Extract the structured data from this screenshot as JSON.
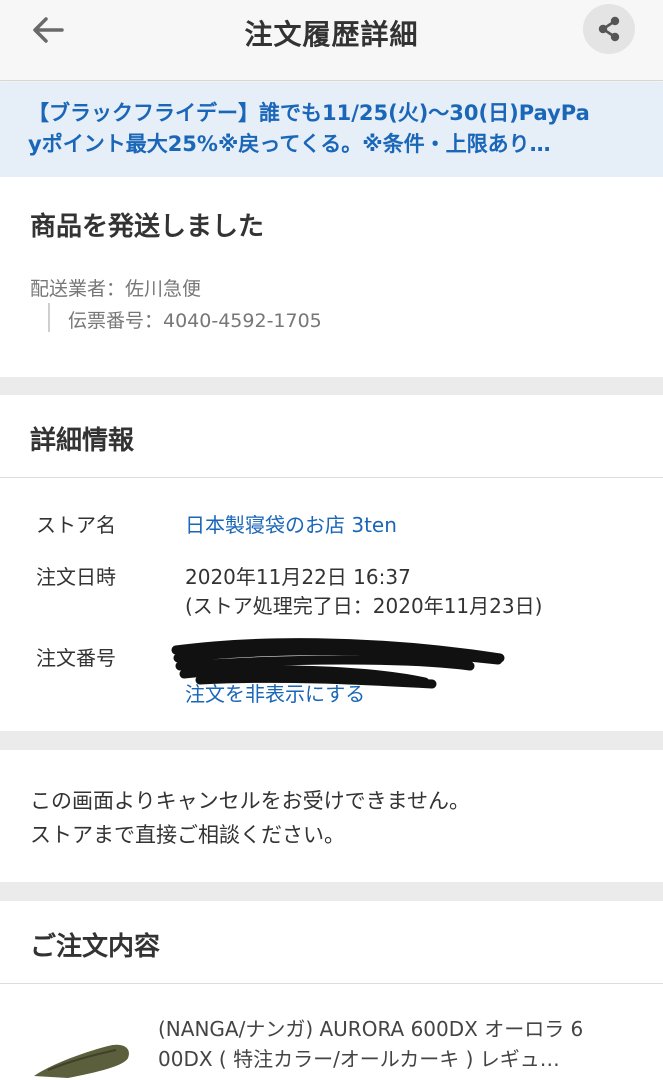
{
  "header": {
    "title": "注文履歴詳細",
    "back_icon": "arrow-left-icon",
    "share_icon": "share-icon"
  },
  "promo": {
    "line1": "【ブラックフライデー】誰でも11/25(火)～30(日)PayPa",
    "line2": "yポイント最大25%※戻ってくる。※条件・上限あり…"
  },
  "shipping": {
    "status": "商品を発送しました",
    "carrier": "配送業者：佐川急便",
    "tracking": "伝票番号：4040-4592-1705"
  },
  "details": {
    "heading": "詳細情報",
    "store_label": "ストア名",
    "store_value": "日本製寝袋のお店 3ten",
    "date_label": "注文日時",
    "date_value": "2020年11月22日 16:37",
    "date_sub": "(ストア処理完了日：2020年11月23日)",
    "order_label": "注文番号",
    "hide_link": "注文を非表示にする"
  },
  "notice": {
    "line1": "この画面よりキャンセルをお受けできません。",
    "line2": "ストアまで直接ご相談ください。"
  },
  "order": {
    "heading": "ご注文内容",
    "product_line1": "(NANGA/ナンガ) AURORA 600DX オーロラ 6",
    "product_line2": "00DX ( 特注カラー/オールカーキ ) レギュ…"
  },
  "colors": {
    "accent": "#1a66b8",
    "promo_bg": "#e6eef7",
    "gap_bg": "#ebebeb"
  }
}
